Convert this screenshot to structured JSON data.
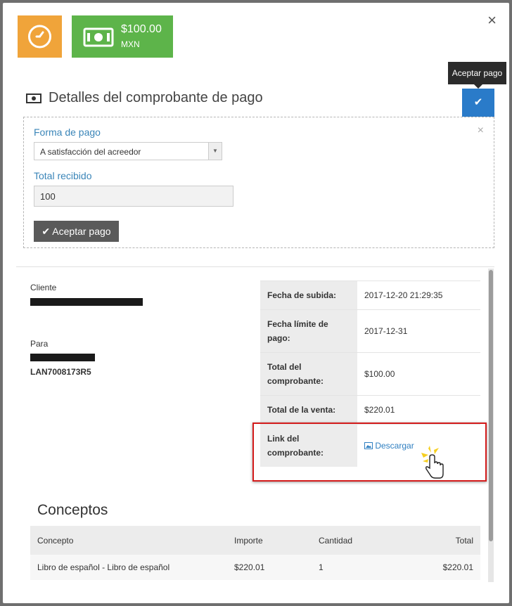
{
  "header": {
    "amount": "$100.00",
    "currency": "MXN",
    "tooltip": "Aceptar pago",
    "close": "×"
  },
  "section": {
    "title": "Detalles del comprobante de pago"
  },
  "form": {
    "payment_method_label": "Forma de pago",
    "payment_method_value": "A satisfacción del acreedor",
    "total_received_label": "Total recibido",
    "total_received_value": "100",
    "accept_button": "Aceptar pago",
    "remove": "×"
  },
  "client": {
    "cliente_label": "Cliente",
    "para_label": "Para",
    "rfc": "LAN7008173R5"
  },
  "details": [
    {
      "key": "Fecha de subida:",
      "value": "2017-12-20 21:29:35"
    },
    {
      "key": "Fecha límite de pago:",
      "value": "2017-12-31"
    },
    {
      "key": "Total del comprobante:",
      "value": "$100.00"
    },
    {
      "key": "Total de la venta:",
      "value": "$220.01"
    },
    {
      "key": "Link del comprobante:",
      "value": "Descargar"
    }
  ],
  "concepts": {
    "title": "Conceptos",
    "headers": [
      "Concepto",
      "Importe",
      "Cantidad",
      "Total"
    ],
    "rows": [
      {
        "concepto": "Libro de español - Libro de español",
        "importe": "$220.01",
        "cantidad": "1",
        "total": "$220.01"
      }
    ]
  },
  "colors": {
    "orange_tile": "#f0a43a",
    "green_tile": "#5db44a",
    "primary": "#2a7bc9",
    "highlight": "#d41c1c"
  },
  "icons": [
    "clock-icon",
    "money-icon",
    "check-icon",
    "image-icon",
    "hand-cursor-icon"
  ]
}
